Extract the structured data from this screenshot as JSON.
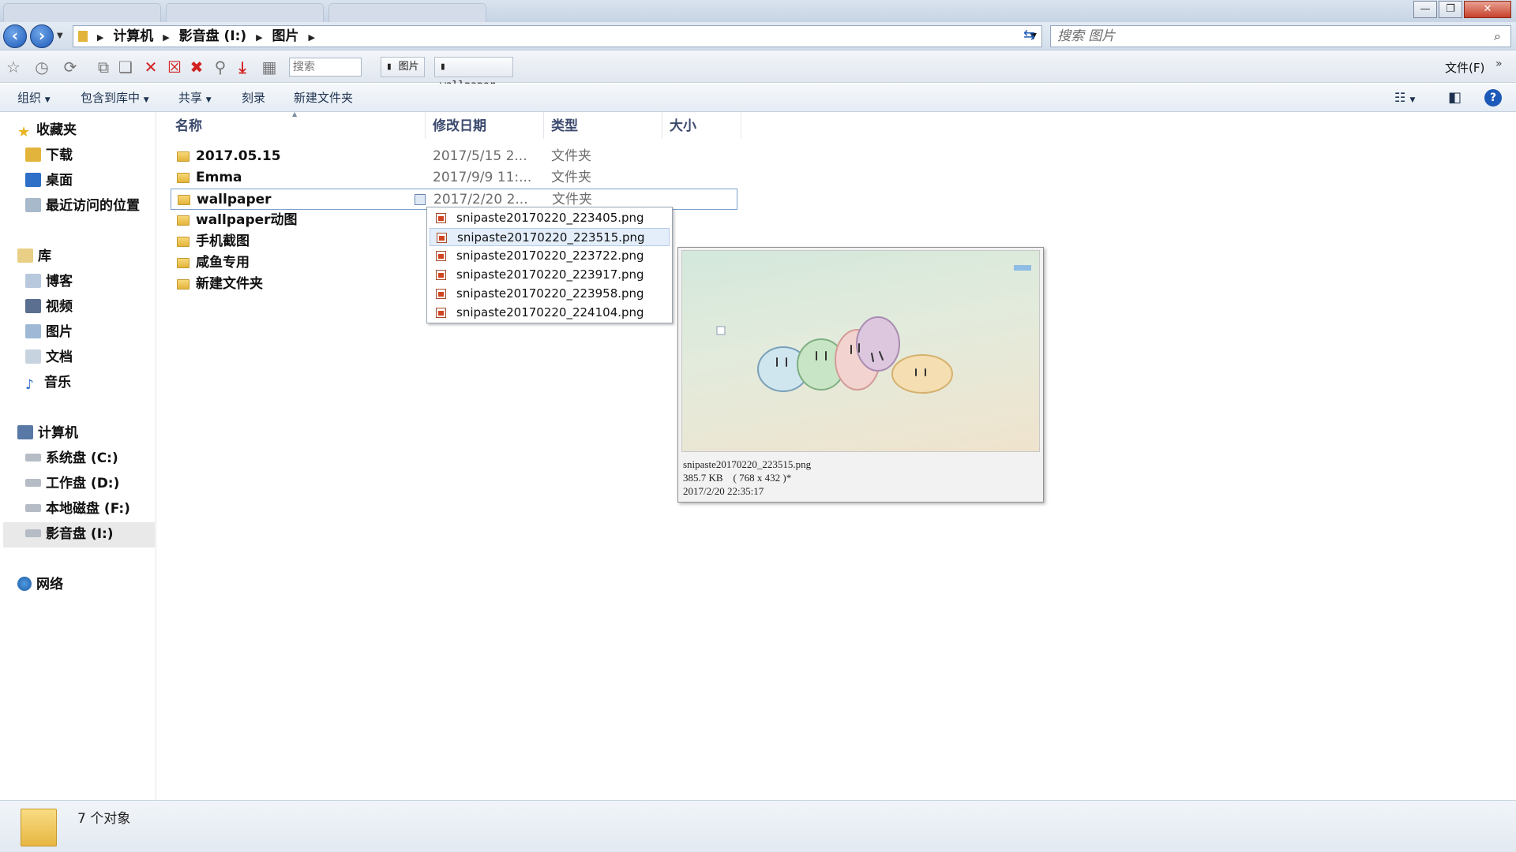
{
  "window": {
    "min_glyph": "—",
    "max_glyph": "❐",
    "close_glyph": "✕"
  },
  "address": {
    "crumbs": [
      "计算机",
      "影音盘 (I:)",
      "图片"
    ],
    "search_placeholder": "搜索 图片"
  },
  "toolbar2": {
    "search_placeholder": "搜索",
    "tabs": [
      "图片",
      "wallpaper"
    ],
    "file_menu": "文件(F)"
  },
  "command_bar": {
    "organize": "组织",
    "include_in_library": "包含到库中",
    "share": "共享",
    "burn": "刻录",
    "new_folder": "新建文件夹"
  },
  "nav": {
    "favorites": {
      "label": "收藏夹",
      "items": [
        "下载",
        "桌面",
        "最近访问的位置"
      ]
    },
    "libraries": {
      "label": "库",
      "items": [
        "博客",
        "视频",
        "图片",
        "文档",
        "音乐"
      ]
    },
    "computer": {
      "label": "计算机",
      "items": [
        "系统盘 (C:)",
        "工作盘 (D:)",
        "本地磁盘 (F:)",
        "影音盘 (I:)"
      ]
    },
    "network": {
      "label": "网络"
    }
  },
  "columns": {
    "name": "名称",
    "modified": "修改日期",
    "type": "类型",
    "size": "大小"
  },
  "files": [
    {
      "name": "2017.05.15",
      "date": "2017/5/15 2...",
      "type": "文件夹"
    },
    {
      "name": "Emma",
      "date": "2017/9/9 11:...",
      "type": "文件夹"
    },
    {
      "name": "wallpaper",
      "date": "2017/2/20 2...",
      "type": "文件夹"
    },
    {
      "name": "wallpaper动图",
      "date": "",
      "type": ""
    },
    {
      "name": "手机截图",
      "date": "",
      "type": ""
    },
    {
      "name": "咸鱼专用",
      "date": "",
      "type": ""
    },
    {
      "name": "新建文件夹",
      "date": "",
      "type": ""
    }
  ],
  "submenu": [
    "snipaste20170220_223405.png",
    "snipaste20170220_223515.png",
    "snipaste20170220_223722.png",
    "snipaste20170220_223917.png",
    "snipaste20170220_223958.png",
    "snipaste20170220_224104.png"
  ],
  "preview": {
    "filename": "snipaste20170220_223515.png",
    "size_line": "385.7 KB    ( 768 x 432 )*",
    "date_line": "2017/2/20 22:35:17"
  },
  "status": {
    "text": "7 个对象"
  },
  "colors": {
    "accent": "#1d59b8",
    "selection_border": "#7da2ce",
    "folder": "#e3b43c",
    "delete_red": "#d12121"
  }
}
